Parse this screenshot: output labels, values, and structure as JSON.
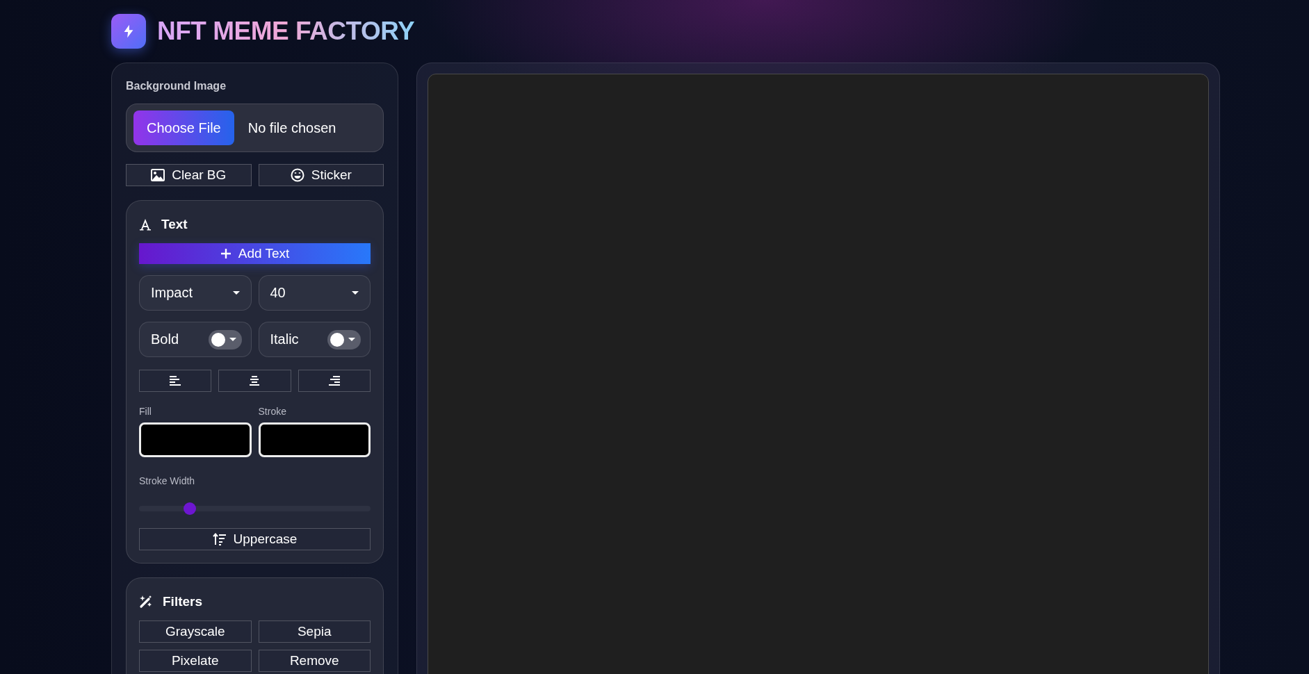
{
  "header": {
    "title": "NFT MEME FACTORY"
  },
  "background_image": {
    "label": "Background Image",
    "file_button": "Choose File",
    "file_status": "No file chosen",
    "buttons": [
      {
        "kind": "image",
        "label": "Clear BG"
      },
      {
        "kind": "smile",
        "label": "Sticker"
      }
    ]
  },
  "text_panel": {
    "title": "Text",
    "add_button": "Add Text",
    "selects": [
      {
        "value": "Impact"
      },
      {
        "value": "40"
      }
    ],
    "toggles": [
      {
        "label": "Bold",
        "on": false
      },
      {
        "label": "Italic",
        "on": false
      }
    ],
    "align_buttons": [
      {
        "kind": "left"
      },
      {
        "kind": "center"
      },
      {
        "kind": "right"
      }
    ],
    "colors": [
      {
        "label": "Fill",
        "color": "#000000"
      },
      {
        "label": "Stroke",
        "color": "#000000"
      }
    ],
    "stroke_width": {
      "label": "Stroke Width",
      "level": 0.22
    },
    "uppercase_button": "Uppercase"
  },
  "filters_panel": {
    "title": "Filters",
    "buttons": [
      "Grayscale",
      "Sepia",
      "Pixelate",
      "Remove"
    ]
  }
}
